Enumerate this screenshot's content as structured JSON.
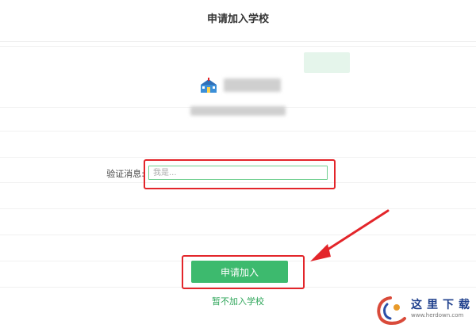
{
  "dialog": {
    "title": "申请加入学校",
    "verify_label": "验证消息:",
    "verify_placeholder": "我是...",
    "apply_button": "申请加入",
    "skip_link": "暂不加入学校"
  },
  "colors": {
    "accent_green": "#3dba6e",
    "highlight_red": "#e3252a",
    "link_green": "#2fa65a"
  },
  "watermark": {
    "name": "这里下载",
    "url": "www.herdown.com"
  }
}
